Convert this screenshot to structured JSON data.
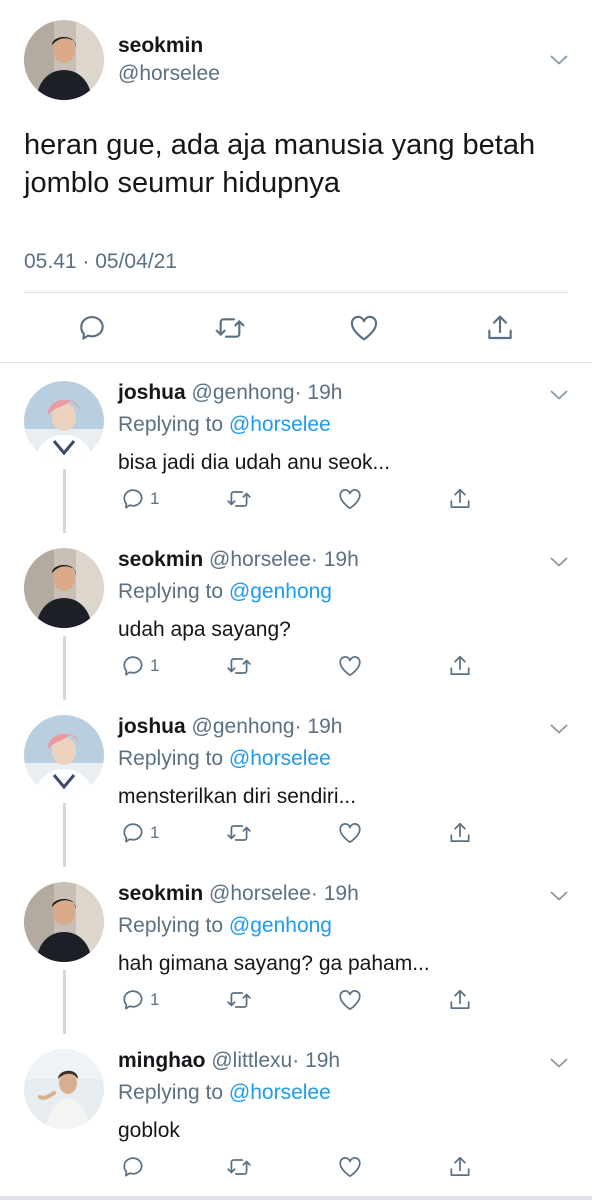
{
  "main_tweet": {
    "name": "seokmin",
    "handle": "@horselee",
    "text": "heran gue, ada aja manusia yang betah jomblo seumur hidupnya",
    "meta": "05.41 · 05/04/21"
  },
  "colors": {
    "accent": "#1d9bf0",
    "secondary_text": "#5b7083",
    "divider": "#dfe3e7"
  },
  "replies": [
    {
      "name": "joshua",
      "handle": "@genhong",
      "time": "· 19h",
      "replying_prefix": "Replying to",
      "mention": "@horselee",
      "text": "bisa jadi dia udah anu seok...",
      "reply_count": "1"
    },
    {
      "name": "seokmin",
      "handle": "@horselee",
      "time": "· 19h",
      "replying_prefix": "Replying to",
      "mention": "@genhong",
      "text": "udah apa sayang?",
      "reply_count": "1"
    },
    {
      "name": "joshua",
      "handle": "@genhong",
      "time": "· 19h",
      "replying_prefix": "Replying to",
      "mention": "@horselee",
      "text": "mensterilkan diri sendiri...",
      "reply_count": "1"
    },
    {
      "name": "seokmin",
      "handle": "@horselee",
      "time": "· 19h",
      "replying_prefix": "Replying to",
      "mention": "@genhong",
      "text": "hah gimana sayang? ga paham...",
      "reply_count": "1"
    },
    {
      "name": "minghao",
      "handle": "@littlexu",
      "time": "· 19h",
      "replying_prefix": "Replying to",
      "mention": "@horselee",
      "text": "goblok",
      "reply_count": ""
    }
  ],
  "icons": {
    "reply": "reply-icon",
    "retweet": "retweet-icon",
    "like": "heart-icon",
    "share": "share-icon",
    "more": "chevron-down-icon"
  }
}
